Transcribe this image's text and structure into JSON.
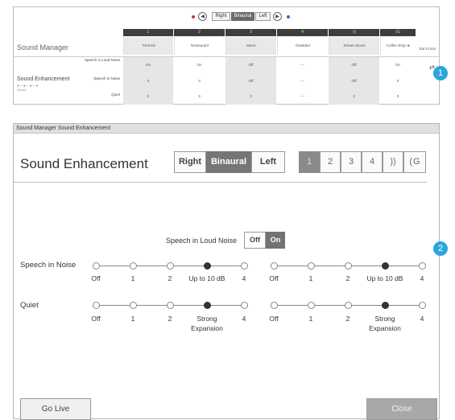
{
  "top": {
    "controls": {
      "right": "Right",
      "binaural": "Binaural",
      "left": "Left"
    },
    "title": "Sound Manager",
    "program_numbers": [
      "1",
      "2",
      "3",
      "4",
      "",
      ""
    ],
    "program_names": [
      "*Normal",
      "Restaurant",
      "Music",
      "Disabled",
      "Stream Boost",
      "Coffee shop ★"
    ],
    "ear_to_ear": "Ear to Ear",
    "section_title": "Sound Enhancement",
    "details": "details",
    "rows": [
      {
        "label": "Speech in Loud Noise",
        "values": [
          "On",
          "On",
          "Off",
          "---",
          "Off",
          "On"
        ]
      },
      {
        "label": "Speech in Noise",
        "values": [
          "3",
          "3",
          "Off",
          "---",
          "Off",
          "3"
        ]
      },
      {
        "label": "Quiet",
        "values": [
          "3",
          "3",
          "3",
          "---",
          "3",
          "3"
        ]
      }
    ],
    "badge": "1"
  },
  "dialog": {
    "title": "Sound Manager Sound Enhancement",
    "heading": "Sound Enhancement",
    "ears": {
      "right": "Right",
      "binaural": "Binaural",
      "left": "Left"
    },
    "programs": [
      "1",
      "2",
      "3",
      "4"
    ],
    "speech_loud_noise": {
      "label": "Speech in Loud Noise",
      "off": "Off",
      "on": "On"
    },
    "speech_in_noise": {
      "label": "Speech in Noise",
      "ticks": [
        "Off",
        "1",
        "2",
        "Up to 10 dB",
        "4"
      ],
      "selected_index": 3
    },
    "quiet": {
      "label": "Quiet",
      "ticks": [
        "Off",
        "1",
        "2",
        "Strong Expansion",
        "4"
      ],
      "selected_index": 3
    },
    "go_live": "Go Live",
    "close": "Close",
    "badge": "2"
  }
}
